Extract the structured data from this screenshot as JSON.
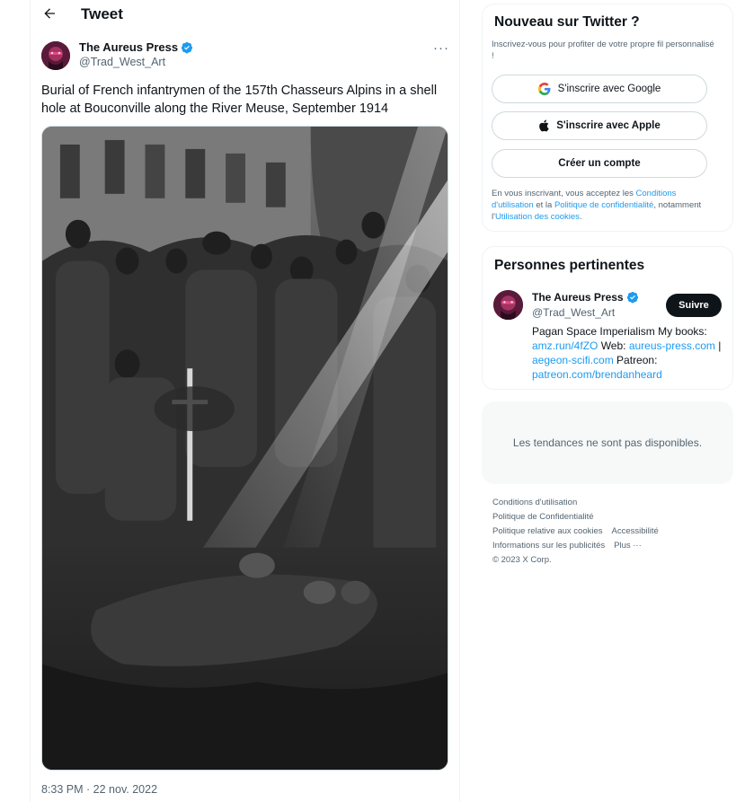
{
  "header": {
    "title": "Tweet"
  },
  "tweet": {
    "author_name": "The Aureus Press",
    "author_handle": "@Trad_West_Art",
    "more_label": "···",
    "text": "Burial of French infantrymen of the 157th Chasseurs Alpins in a shell hole at Bouconville along the River Meuse, September 1914",
    "timestamp": "8:33 PM · 22 nov. 2022"
  },
  "signup": {
    "title": "Nouveau sur Twitter ?",
    "subtitle": "Inscrivez-vous pour profiter de votre propre fil personnalisé !",
    "google_label": "S'inscrire avec Google",
    "apple_label": "S'inscrire avec Apple",
    "create_label": "Créer un compte",
    "legal_prefix": "En vous inscrivant, vous acceptez les ",
    "legal_terms": "Conditions d'utilisation",
    "legal_middle": " et la ",
    "legal_privacy": "Politique de confidentialité",
    "legal_middle2": ", notamment l'",
    "legal_cookies": "Utilisation des cookies",
    "legal_suffix": "."
  },
  "relevant": {
    "title": "Personnes pertinentes",
    "name": "The Aureus Press",
    "handle": "@Trad_West_Art",
    "follow_label": "Suivre",
    "bio_text1": "Pagan Space Imperialism My books: ",
    "bio_link1": "amz.run/4fZO",
    "bio_text2": " Web: ",
    "bio_link2": "aureus-press.com",
    "bio_text3": " | ",
    "bio_link3": "aegeon-scifi.com",
    "bio_text4": " Patreon: ",
    "bio_link4": "patreon.com/brendanheard"
  },
  "trends": {
    "unavailable": "Les tendances ne sont pas disponibles."
  },
  "footer": {
    "terms": "Conditions d'utilisation",
    "privacy": "Politique de Confidentialité",
    "cookies": "Politique relative aux cookies",
    "accessibility": "Accessibilité",
    "ads": "Informations sur les publicités",
    "more": "Plus ···",
    "copyright": "© 2023 X Corp."
  },
  "colors": {
    "accent": "#1d9bf0",
    "text": "#0f1419",
    "muted": "#536471",
    "border": "#eff3f4"
  },
  "icons": {
    "back": "arrow-left-icon",
    "verified": "verified-badge-icon",
    "more": "more-icon",
    "google": "google-icon",
    "apple": "apple-icon"
  }
}
